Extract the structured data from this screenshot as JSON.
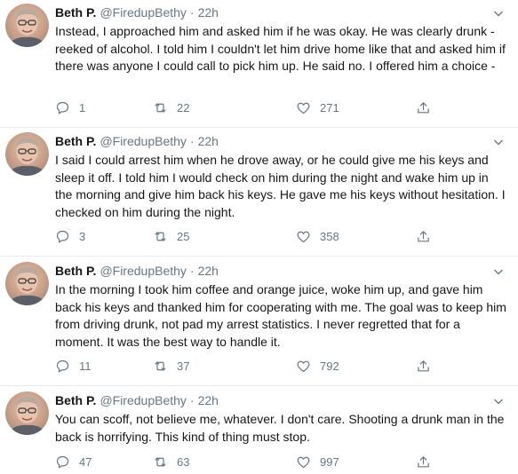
{
  "tweets": [
    {
      "author": "Beth P.",
      "handle": "@FiredupBethy",
      "separator": "·",
      "time": "22h",
      "text": "Instead, I approached him and asked him if he was okay.  He was clearly drunk - reeked of alcohol.  I told him I couldn't let him drive home like that and asked him if there was anyone I could call to pick him up.  He said no.  I offered him a choice -",
      "replies": "1",
      "retweets": "22",
      "likes": "271",
      "avatar_icon": "profile-avatar",
      "reply_icon": "comment-bubble",
      "retweet_icon": "retweet-arrows",
      "like_icon": "heart-outline",
      "share_icon": "share-upload"
    },
    {
      "author": "Beth P.",
      "handle": "@FiredupBethy",
      "separator": "·",
      "time": "22h",
      "text": "I said I could arrest him when he drove away, or he could give me his keys and sleep it off.  I told him I would check on him during the night and wake him up in the morning and give him back his keys.  He gave me his keys without hesitation.  I checked on him during the night.",
      "replies": "3",
      "retweets": "25",
      "likes": "358",
      "avatar_icon": "profile-avatar",
      "reply_icon": "comment-bubble",
      "retweet_icon": "retweet-arrows",
      "like_icon": "heart-outline",
      "share_icon": "share-upload"
    },
    {
      "author": "Beth P.",
      "handle": "@FiredupBethy",
      "separator": "·",
      "time": "22h",
      "text": "In the morning I took him coffee and orange juice, woke him up, and gave him back his keys and thanked him for cooperating with me. The goal was to keep him from driving drunk, not pad my arrest statistics.  I never regretted that for a moment.  It was the best way to handle it.",
      "replies": "11",
      "retweets": "37",
      "likes": "792",
      "avatar_icon": "profile-avatar",
      "reply_icon": "comment-bubble",
      "retweet_icon": "retweet-arrows",
      "like_icon": "heart-outline",
      "share_icon": "share-upload"
    },
    {
      "author": "Beth P.",
      "handle": "@FiredupBethy",
      "separator": "·",
      "time": "22h",
      "text": "You can scoff, not believe me, whatever.  I don't care.  Shooting a drunk man in the back is horrifying. This kind of thing must stop.",
      "replies": "47",
      "retweets": "63",
      "likes": "997",
      "avatar_icon": "profile-avatar",
      "reply_icon": "comment-bubble",
      "retweet_icon": "retweet-arrows",
      "like_icon": "heart-outline",
      "share_icon": "share-upload"
    }
  ],
  "colors": {
    "text": "#14171a",
    "secondary": "#657786",
    "divider": "#e6ecf0",
    "background": "#ffffff"
  }
}
